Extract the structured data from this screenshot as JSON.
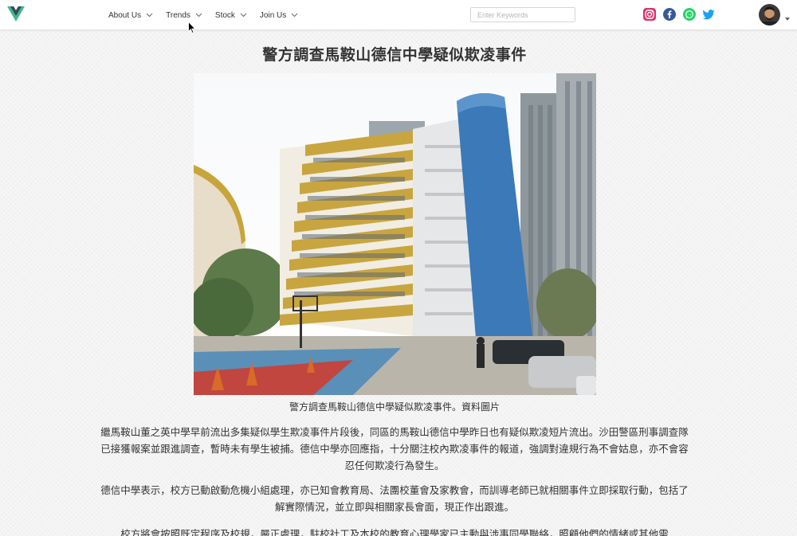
{
  "header": {
    "nav": [
      {
        "label": "About Us"
      },
      {
        "label": "Trends"
      },
      {
        "label": "Stock"
      },
      {
        "label": "Join Us"
      }
    ],
    "search": {
      "placeholder": "Enter Keywords"
    },
    "social_icons": [
      "instagram-icon",
      "facebook-icon",
      "whatsapp-icon",
      "twitter-icon"
    ]
  },
  "article": {
    "title": "警方調查馬鞍山德信中學疑似欺凌事件",
    "image_caption": "警方調查馬鞍山德信中學疑似欺凌事件。資料圖片",
    "paragraphs": [
      "繼馬鞍山董之英中學早前流出多集疑似學生欺凌事件片段後，同區的馬鞍山德信中學昨日也有疑似欺凌短片流出。沙田警區刑事調查隊已接獲報案並跟進調查，暫時未有學生被捕。德信中學亦回應指，十分關注校內欺凌事件的報道，強調對違規行為不會姑息，亦不會容忍任何欺凌行為發生。",
      "德信中學表示，校方已動啟動危機小組處理，亦已知會教育局、法團校董會及家教會，而訓導老師已就相關事件立即採取行動，包括了解實際情況，並立即與相關家長會面，現正作出跟進。",
      "校方將會按照既定程序及校規，嚴正處理，駐校社工及本校的教育心理學家已主動與涉事同學聯絡，照顧他們的情緒或其他需"
    ]
  },
  "colors": {
    "vue_green": "#41b883",
    "vue_dark": "#35495e",
    "instagram": "#e1306c",
    "facebook": "#3b5998",
    "whatsapp": "#25d366",
    "twitter": "#1da1f2"
  }
}
